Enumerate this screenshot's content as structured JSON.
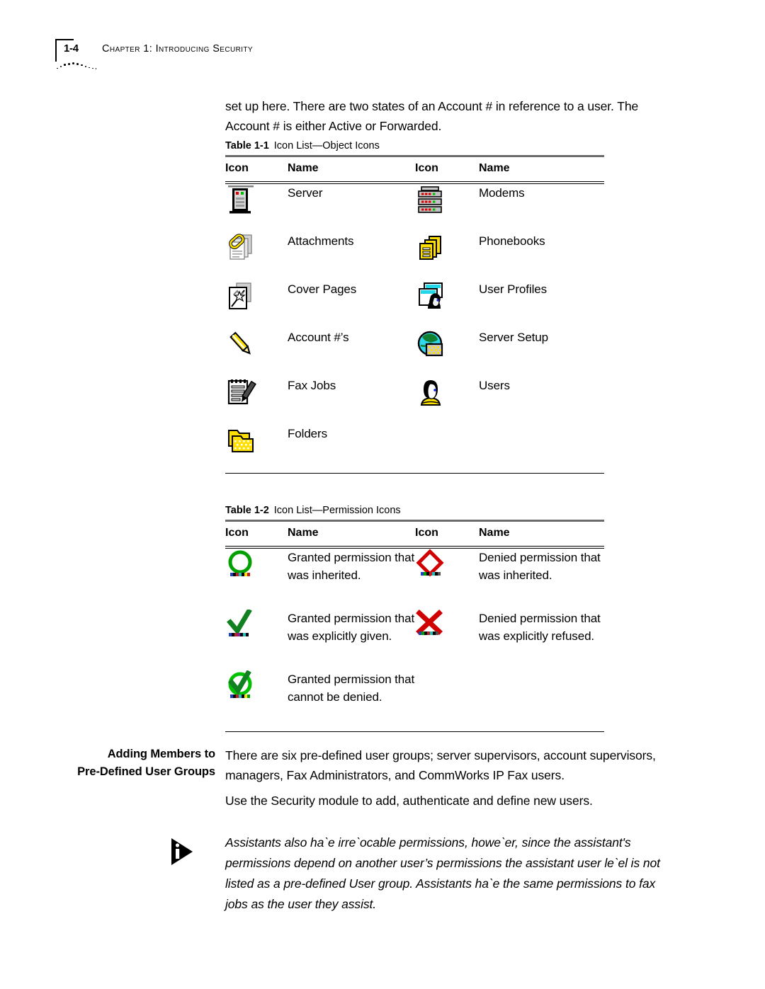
{
  "header": {
    "folio": "1-4",
    "chapter": "Chapter 1: Introducing Security"
  },
  "intro": {
    "paragraph": "set up here. There are two states of an Account # in reference to a user. The Account # is either Active or Forwarded."
  },
  "table1": {
    "caption_label": "Table 1-1",
    "caption_title": "Icon List—Object Icons",
    "headers": [
      "Icon",
      "Name",
      "Icon",
      "Name"
    ],
    "rows": [
      {
        "left_icon": "server-icon",
        "left_name": "Server",
        "right_icon": "modems-icon",
        "right_name": "Modems"
      },
      {
        "left_icon": "attachments-icon",
        "left_name": "Attachments",
        "right_icon": "phonebooks-icon",
        "right_name": "Phonebooks"
      },
      {
        "left_icon": "cover-pages-icon",
        "left_name": "Cover Pages",
        "right_icon": "user-profiles-icon",
        "right_name": "User Profiles"
      },
      {
        "left_icon": "account-numbers-icon",
        "left_name": "Account #’s",
        "right_icon": "server-setup-icon",
        "right_name": "Server Setup"
      },
      {
        "left_icon": "fax-jobs-icon",
        "left_name": "Fax Jobs",
        "right_icon": "users-icon",
        "right_name": "Users"
      },
      {
        "left_icon": "folders-icon",
        "left_name": "Folders",
        "right_icon": "",
        "right_name": ""
      }
    ]
  },
  "table2": {
    "caption_label": "Table 1-2",
    "caption_title": "Icon List—Permission Icons",
    "headers": [
      "Icon",
      "Name",
      "Icon",
      "Name"
    ],
    "rows": [
      {
        "left_icon": "green-circle-icon",
        "left_name": "Granted permission that was inherited.",
        "right_icon": "red-diamond-icon",
        "right_name": "Denied permission that was inherited."
      },
      {
        "left_icon": "green-check-icon",
        "left_name": "Granted permission that was explicitly given.",
        "right_icon": "red-x-icon",
        "right_name": "Denied permission that was explicitly refused."
      },
      {
        "left_icon": "green-circle-check-icon",
        "left_name": "Granted permission that cannot be denied.",
        "right_icon": "",
        "right_name": ""
      }
    ]
  },
  "section": {
    "side_heading_line1": "Adding Members to",
    "side_heading_line2": "Pre-Defined User Groups",
    "paragraph1": "There are six pre-defined user groups; server supervisors, account supervisors, managers, Fax Administrators, and CommWorks IP Fax users.",
    "paragraph2": "Use the Security module to add, authenticate and define new users."
  },
  "note": {
    "icon": "info-triangle-icon",
    "text": "Assistants also haˋe irreˋocable permissions, howeˋer, since the assistant's permissions depend on another user’s permissions the assistant user leˋel is not listed as a pre-defined User group. Assistants haˋe the same permissions to fax jobs as the user they assist."
  }
}
